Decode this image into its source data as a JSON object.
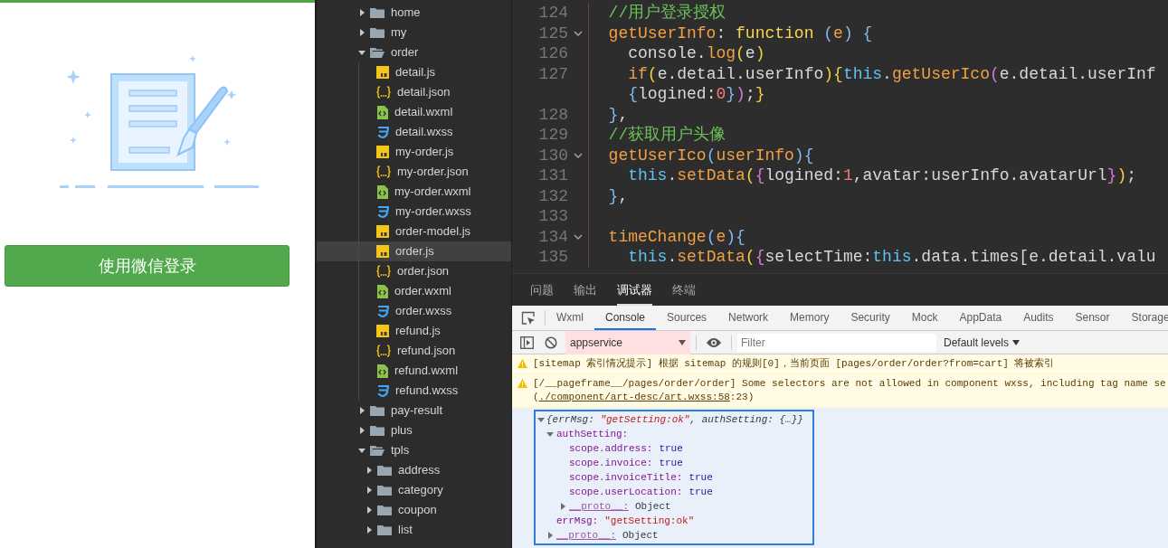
{
  "login_panel": {
    "button": "使用微信登录"
  },
  "file_tree": [
    {
      "name": "home",
      "kind": "folder",
      "expanded": false
    },
    {
      "name": "my",
      "kind": "folder",
      "expanded": false
    },
    {
      "name": "order",
      "kind": "folder",
      "expanded": true,
      "children": [
        {
          "name": "detail.js",
          "kind": "js",
          "selected": false
        },
        {
          "name": "detail.json",
          "kind": "json",
          "selected": false
        },
        {
          "name": "detail.wxml",
          "kind": "wxml",
          "selected": false
        },
        {
          "name": "detail.wxss",
          "kind": "wxss",
          "selected": false
        },
        {
          "name": "my-order.js",
          "kind": "js",
          "selected": false
        },
        {
          "name": "my-order.json",
          "kind": "json",
          "selected": false
        },
        {
          "name": "my-order.wxml",
          "kind": "wxml",
          "selected": false
        },
        {
          "name": "my-order.wxss",
          "kind": "wxss",
          "selected": false
        },
        {
          "name": "order-model.js",
          "kind": "js",
          "selected": false
        },
        {
          "name": "order.js",
          "kind": "js",
          "selected": true
        },
        {
          "name": "order.json",
          "kind": "json",
          "selected": false
        },
        {
          "name": "order.wxml",
          "kind": "wxml",
          "selected": false
        },
        {
          "name": "order.wxss",
          "kind": "wxss",
          "selected": false
        },
        {
          "name": "refund.js",
          "kind": "js",
          "selected": false
        },
        {
          "name": "refund.json",
          "kind": "json",
          "selected": false
        },
        {
          "name": "refund.wxml",
          "kind": "wxml",
          "selected": false
        },
        {
          "name": "refund.wxss",
          "kind": "wxss",
          "selected": false
        }
      ]
    },
    {
      "name": "pay-result",
      "kind": "folder",
      "expanded": false
    },
    {
      "name": "plus",
      "kind": "folder",
      "expanded": false
    },
    {
      "name": "tpls",
      "kind": "folder",
      "expanded": true,
      "children": [
        {
          "name": "address",
          "kind": "folder",
          "expanded": false
        },
        {
          "name": "category",
          "kind": "folder",
          "expanded": false
        },
        {
          "name": "coupon",
          "kind": "folder",
          "expanded": false
        },
        {
          "name": "list",
          "kind": "folder",
          "expanded": false
        }
      ]
    }
  ],
  "editor": {
    "lines": [
      {
        "number": "124",
        "fold": false,
        "tokens": [
          {
            "t": "  //用户登录授权",
            "kind": "comment"
          }
        ]
      },
      {
        "number": "125",
        "fold": true,
        "tokens": [
          {
            "t": "  getUserInfo",
            "kind": "name"
          },
          {
            "t": ": ",
            "kind": "plain"
          },
          {
            "t": "function",
            "kind": "keyword"
          },
          {
            "t": " (",
            "kind": "blue"
          },
          {
            "t": "e",
            "kind": "name"
          },
          {
            "t": ")",
            "kind": "blue"
          },
          {
            "t": " {",
            "kind": "blue"
          }
        ]
      },
      {
        "number": "126",
        "fold": false,
        "tokens": [
          {
            "t": "    console",
            "kind": "plain"
          },
          {
            "t": ".",
            "kind": "plain"
          },
          {
            "t": "log",
            "kind": "name"
          },
          {
            "t": "(",
            "kind": "yellow"
          },
          {
            "t": "e",
            "kind": "plain"
          },
          {
            "t": ")",
            "kind": "yellow"
          }
        ]
      },
      {
        "number": "127",
        "fold": false,
        "tokens": [
          {
            "t": "    if",
            "kind": "name"
          },
          {
            "t": "(",
            "kind": "yellow"
          },
          {
            "t": "e.detail.userInfo",
            "kind": "plain"
          },
          {
            "t": ")",
            "kind": "yellow"
          },
          {
            "t": "{",
            "kind": "yellow"
          },
          {
            "t": "this",
            "kind": "this"
          },
          {
            "t": ".",
            "kind": "plain"
          },
          {
            "t": "getUserIco",
            "kind": "name"
          },
          {
            "t": "(",
            "kind": "purple"
          },
          {
            "t": "e.detail.userInf",
            "kind": "plain"
          }
        ]
      },
      {
        "tokens": [
          {
            "t": "    {",
            "kind": "blue"
          },
          {
            "t": "logined:",
            "kind": "plain"
          },
          {
            "t": "0",
            "kind": "number"
          },
          {
            "t": "}",
            "kind": "blue"
          },
          {
            "t": ")",
            "kind": "purple"
          },
          {
            "t": ";",
            "kind": "plain"
          },
          {
            "t": "}",
            "kind": "yellow"
          }
        ]
      },
      {
        "number": "128",
        "fold": false,
        "tokens": [
          {
            "t": "  }",
            "kind": "blue"
          },
          {
            "t": ",",
            "kind": "plain"
          }
        ]
      },
      {
        "number": "129",
        "fold": false,
        "tokens": [
          {
            "t": "  //获取用户头像",
            "kind": "comment"
          }
        ]
      },
      {
        "number": "130",
        "fold": true,
        "tokens": [
          {
            "t": "  getUserIco",
            "kind": "name"
          },
          {
            "t": "(",
            "kind": "blue"
          },
          {
            "t": "userInfo",
            "kind": "name"
          },
          {
            "t": ")",
            "kind": "blue"
          },
          {
            "t": "{",
            "kind": "blue"
          }
        ]
      },
      {
        "number": "131",
        "fold": false,
        "tokens": [
          {
            "t": "    this",
            "kind": "this"
          },
          {
            "t": ".",
            "kind": "plain"
          },
          {
            "t": "setData",
            "kind": "name"
          },
          {
            "t": "(",
            "kind": "yellow"
          },
          {
            "t": "{",
            "kind": "purple"
          },
          {
            "t": "logined:",
            "kind": "plain"
          },
          {
            "t": "1",
            "kind": "number"
          },
          {
            "t": ",avatar:userInfo.avatarUrl",
            "kind": "plain"
          },
          {
            "t": "}",
            "kind": "purple"
          },
          {
            "t": ")",
            "kind": "yellow"
          },
          {
            "t": ";",
            "kind": "plain"
          }
        ]
      },
      {
        "number": "132",
        "fold": false,
        "tokens": [
          {
            "t": "  }",
            "kind": "blue"
          },
          {
            "t": ",",
            "kind": "plain"
          }
        ]
      },
      {
        "number": "133",
        "fold": false
      },
      {
        "number": "134",
        "fold": true,
        "tokens": [
          {
            "t": "  timeChange",
            "kind": "name"
          },
          {
            "t": "(",
            "kind": "blue"
          },
          {
            "t": "e",
            "kind": "name"
          },
          {
            "t": ")",
            "kind": "blue"
          },
          {
            "t": "{",
            "kind": "blue"
          }
        ]
      },
      {
        "number": "135",
        "fold": false,
        "tokens": [
          {
            "t": "    this",
            "kind": "this"
          },
          {
            "t": ".",
            "kind": "plain"
          },
          {
            "t": "setData",
            "kind": "name"
          },
          {
            "t": "(",
            "kind": "yellow"
          },
          {
            "t": "{",
            "kind": "purple"
          },
          {
            "t": "selectTime:",
            "kind": "plain"
          },
          {
            "t": "this",
            "kind": "this"
          },
          {
            "t": ".data.times[e.detail.valu",
            "kind": "plain"
          }
        ]
      }
    ]
  },
  "panel_tabs": [
    {
      "label": "问题",
      "selected": false
    },
    {
      "label": "输出",
      "selected": false
    },
    {
      "label": "调试器",
      "selected": true
    },
    {
      "label": "终端",
      "selected": false
    }
  ],
  "devtools_tabs": [
    {
      "label": "Wxml",
      "selected": false
    },
    {
      "label": "Console",
      "selected": true
    },
    {
      "label": "Sources",
      "selected": false
    },
    {
      "label": "Network",
      "selected": false
    },
    {
      "label": "Memory",
      "selected": false
    },
    {
      "label": "Security",
      "selected": false
    },
    {
      "label": "Mock",
      "selected": false
    },
    {
      "label": "AppData",
      "selected": false
    },
    {
      "label": "Audits",
      "selected": false
    },
    {
      "label": "Sensor",
      "selected": false
    },
    {
      "label": "Storage",
      "selected": false
    }
  ],
  "console_toolbar": {
    "context": "appservice",
    "filter_placeholder": "Filter",
    "levels": "Default levels"
  },
  "messages": [
    {
      "kind": "warning",
      "text": "[sitemap 索引情况提示] 根据 sitemap 的规则[0]，当前页面 [pages/order/order?from=cart] 将被索引"
    },
    {
      "kind": "warning",
      "text": "[/__pageframe__/pages/order/order] Some selectors are not allowed in component wxss, including tag name se",
      "source": {
        "prefix": "(",
        "link": "./component/art-desc/art.wxss:58",
        "suffix": ":23)"
      }
    }
  ],
  "object": {
    "summary": [
      {
        "t": "{errMsg: ",
        "kind": "plain"
      },
      {
        "t": "\"getSetting:ok\"",
        "kind": "string"
      },
      {
        "t": ", authSetting: {…}}",
        "kind": "plain"
      }
    ],
    "expanded": true,
    "children": [
      {
        "key": "authSetting:",
        "expanded": true,
        "children": [
          {
            "key": "scope.address:",
            "value": "true",
            "kind": "boolean"
          },
          {
            "key": "scope.invoice:",
            "value": "true",
            "kind": "boolean"
          },
          {
            "key": "scope.invoiceTitle:",
            "value": "true",
            "kind": "boolean"
          },
          {
            "key": "scope.userLocation:",
            "value": "true",
            "kind": "boolean"
          },
          {
            "key": "__proto__:",
            "value": "Object",
            "kind": "object",
            "expanded": false
          }
        ]
      },
      {
        "key": "errMsg:",
        "value": "\"getSetting:ok\"",
        "kind": "string"
      },
      {
        "key": "__proto__:",
        "value": "Object",
        "kind": "object",
        "expanded": false
      }
    ]
  }
}
